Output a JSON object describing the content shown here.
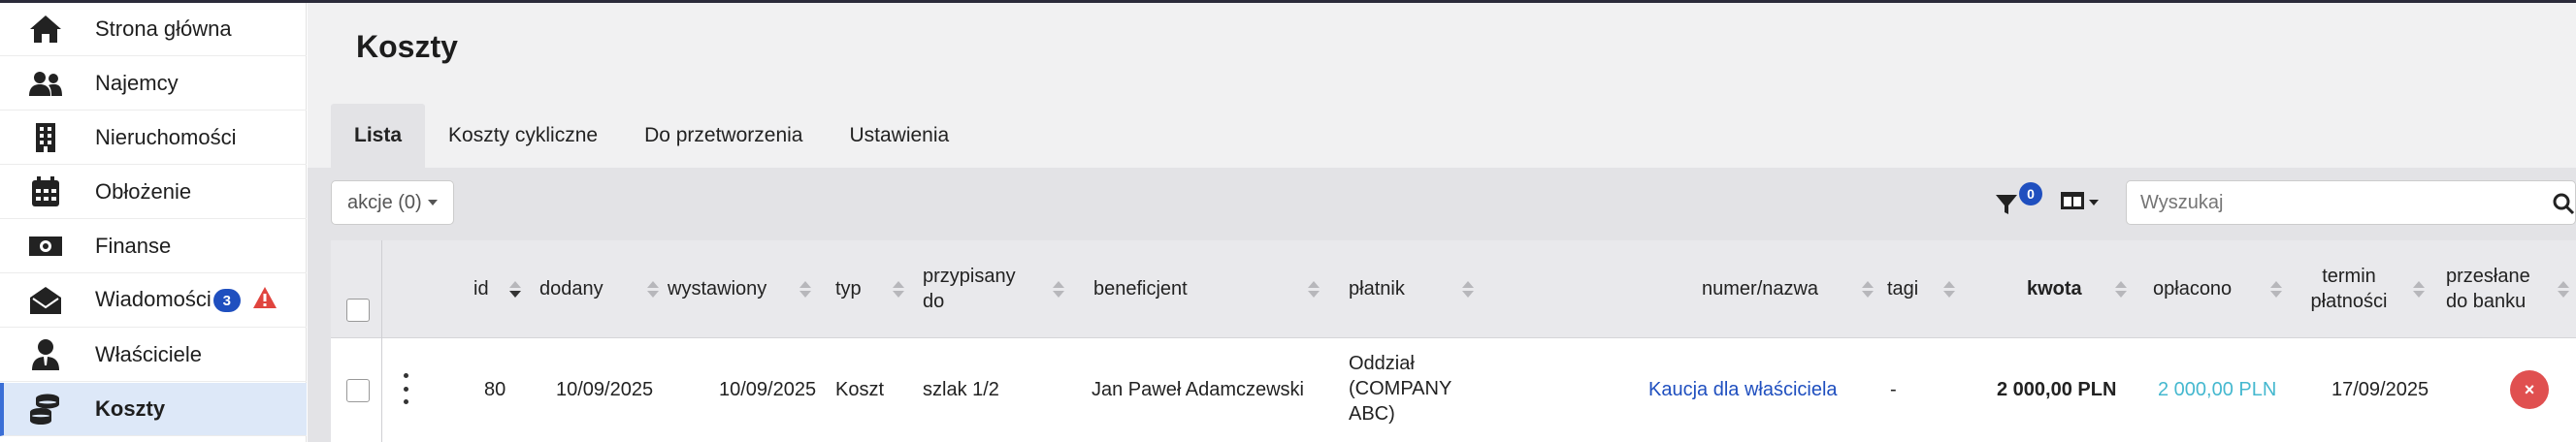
{
  "sidebar": {
    "items": [
      {
        "label": "Strona główna",
        "icon": "home-icon"
      },
      {
        "label": "Najemcy",
        "icon": "users-icon"
      },
      {
        "label": "Nieruchomości",
        "icon": "building-icon"
      },
      {
        "label": "Obłożenie",
        "icon": "calendar-icon"
      },
      {
        "label": "Finanse",
        "icon": "money-icon"
      },
      {
        "label": "Wiadomości",
        "icon": "envelope-icon",
        "badge": "3",
        "warning": "warning-icon"
      },
      {
        "label": "Właściciele",
        "icon": "owner-icon"
      },
      {
        "label": "Koszty",
        "icon": "coins-icon",
        "active": true
      }
    ]
  },
  "header": {
    "title": "Koszty"
  },
  "tabs": [
    {
      "label": "Lista",
      "active": true
    },
    {
      "label": "Koszty cykliczne"
    },
    {
      "label": "Do przetworzenia"
    },
    {
      "label": "Ustawienia"
    }
  ],
  "toolbar": {
    "actions_label": "akcje (0)",
    "filter_count": "0",
    "search_placeholder": "Wyszukaj"
  },
  "table": {
    "columns": {
      "id": "id",
      "dodany": "dodany",
      "wystawiony": "wystawiony",
      "typ": "typ",
      "przypisany_1": "przypisany",
      "przypisany_2": "do",
      "beneficjent": "beneficjent",
      "platnik": "płatnik",
      "numer": "numer/nazwa",
      "tagi": "tagi",
      "kwota": "kwota",
      "oplacono": "opłacono",
      "termin_1": "termin",
      "termin_2": "płatności",
      "przeslane_1": "przesłane",
      "przeslane_2": "do banku"
    },
    "rows": [
      {
        "id": "80",
        "dodany": "10/09/2025",
        "wystawiony": "10/09/2025",
        "typ": "Koszt",
        "przypisany": "szlak 1/2",
        "beneficjent": "Jan Paweł Adamczewski",
        "platnik_1": "Oddział",
        "platnik_2": "(COMPANY",
        "platnik_3": "ABC)",
        "numer": "Kaucja dla właściciela",
        "tagi": "-",
        "kwota": "2 000,00 PLN",
        "oplacono": "2 000,00 PLN",
        "termin": "17/09/2025",
        "przeslane_icon": "close-icon",
        "przeslane_symbol": "×"
      }
    ]
  },
  "colors": {
    "accent": "#1f4fbf",
    "active_sidebar": "#dde8f8",
    "paid": "#45b8cf",
    "danger": "#e05050"
  }
}
